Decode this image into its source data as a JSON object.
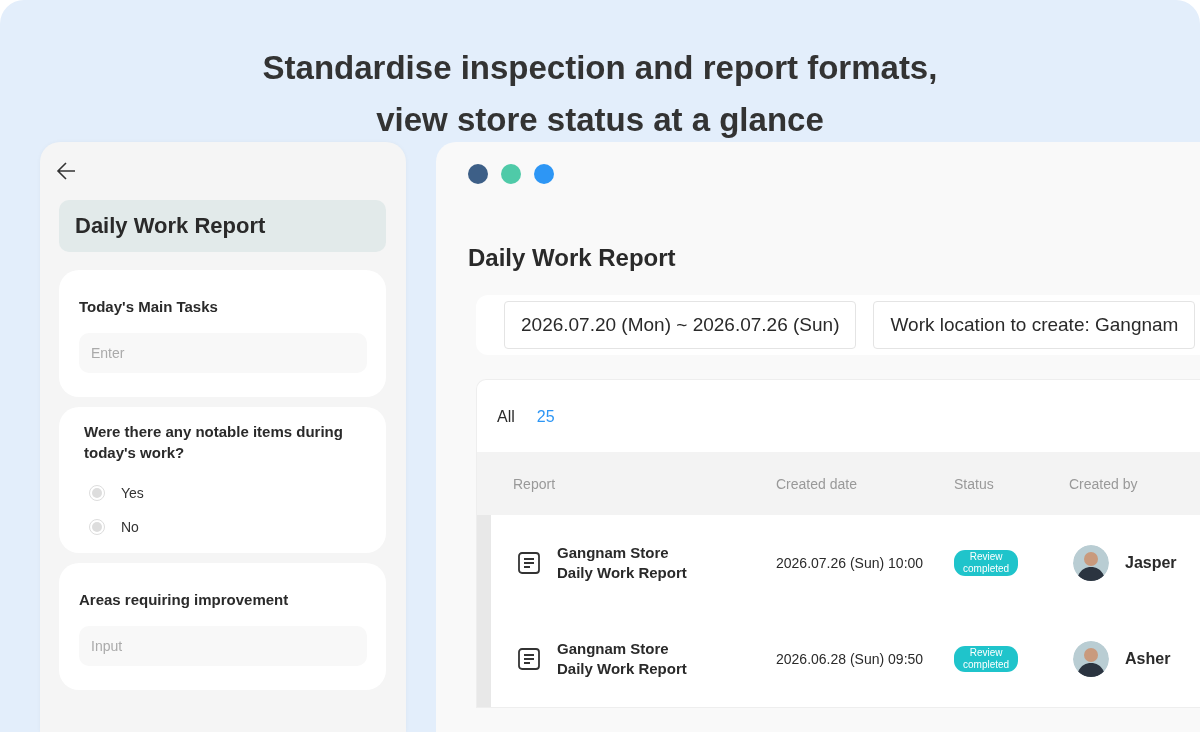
{
  "headline": [
    "Standardise inspection and report formats,",
    "view store status at a glance"
  ],
  "mobile_form": {
    "title": "Daily Work Report",
    "sections": [
      {
        "kind": "text",
        "label": "Today's Main Tasks",
        "placeholder": "Enter"
      },
      {
        "kind": "radio",
        "label": "Were there any notable items during today's work?",
        "options": [
          {
            "label": "Yes",
            "selected": false
          },
          {
            "label": "No",
            "selected": false
          }
        ]
      },
      {
        "kind": "text",
        "label": "Areas requiring improvement",
        "placeholder": "Input"
      }
    ]
  },
  "window": {
    "title": "Daily Work Report",
    "date_range": "2026.07.20 (Mon) ~ 2026.07.26 (Sun)",
    "location": "Work location to create: Gangnam",
    "filter": {
      "label": "All",
      "count": "25"
    },
    "table": {
      "columns": [
        "Report",
        "Created date",
        "Status",
        "Created by"
      ],
      "rows": [
        {
          "report": [
            "Gangnam Store",
            "Daily Work Report"
          ],
          "created_date": "2026.07.26 (Sun) 10:00",
          "status": [
            "Review",
            "completed"
          ],
          "created_by": "Jasper"
        },
        {
          "report": [
            "Gangnam Store",
            "Daily Work Report"
          ],
          "created_date": "2026.06.28 (Sun) 09:50",
          "status": [
            "Review",
            "completed"
          ],
          "created_by": "Asher"
        }
      ]
    }
  }
}
